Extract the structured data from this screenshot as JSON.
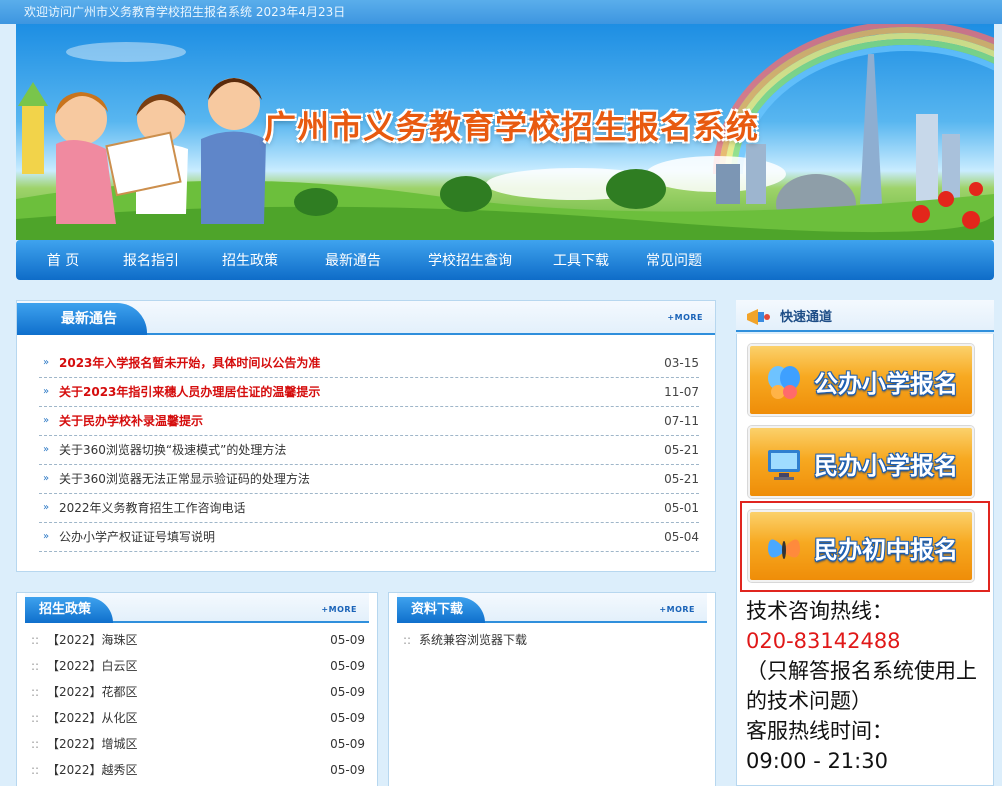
{
  "topbar": {
    "welcome": "欢迎访问广州市义务教育学校招生报名系统 2023年4月23日"
  },
  "banner": {
    "title": "广州市义务教育学校招生报名系统"
  },
  "nav": [
    {
      "label": "首 页"
    },
    {
      "label": "报名指引"
    },
    {
      "label": "招生政策"
    },
    {
      "label": "最新通告"
    },
    {
      "label": "学校招生查询"
    },
    {
      "label": "工具下载"
    },
    {
      "label": "常见问题"
    }
  ],
  "notices": {
    "title": "最新通告",
    "more": "+MORE",
    "items": [
      {
        "text": "2023年入学报名暂未开始，具体时间以公告为准",
        "date": "03-15",
        "highlight": true
      },
      {
        "text": "关于2023年指引来穗人员办理居住证的温馨提示",
        "date": "11-07",
        "highlight": true
      },
      {
        "text": "关于民办学校补录温馨提示",
        "date": "07-11",
        "highlight": true
      },
      {
        "text": "关于360浏览器切换“极速模式”的处理方法",
        "date": "05-21",
        "highlight": false
      },
      {
        "text": "关于360浏览器无法正常显示验证码的处理方法",
        "date": "05-21",
        "highlight": false
      },
      {
        "text": "2022年义务教育招生工作咨询电话",
        "date": "05-01",
        "highlight": false
      },
      {
        "text": "公办小学产权证证号填写说明",
        "date": "05-04",
        "highlight": false
      }
    ]
  },
  "policy": {
    "title": "招生政策",
    "more": "+MORE",
    "items": [
      {
        "text": "【2022】海珠区",
        "date": "05-09"
      },
      {
        "text": "【2022】白云区",
        "date": "05-09"
      },
      {
        "text": "【2022】花都区",
        "date": "05-09"
      },
      {
        "text": "【2022】从化区",
        "date": "05-09"
      },
      {
        "text": "【2022】增城区",
        "date": "05-09"
      },
      {
        "text": "【2022】越秀区",
        "date": "05-09"
      }
    ]
  },
  "downloads": {
    "title": "资料下载",
    "more": "+MORE",
    "items": [
      {
        "text": "系统兼容浏览器下载"
      }
    ]
  },
  "quick": {
    "title": "快速通道",
    "buttons": [
      {
        "label": "公办小学报名",
        "icon": "butterfly-icon"
      },
      {
        "label": "民办小学报名",
        "icon": "computer-icon"
      },
      {
        "label": "民办初中报名",
        "icon": "butterfly-icon"
      }
    ]
  },
  "hotline": {
    "label": "技术咨询热线：",
    "phone": "020-83142488",
    "note": "（只解答报名系统使用上的技术问题）",
    "hours_label": "客服热线时间：",
    "hours": "09:00 - 21:30"
  },
  "colors": {
    "accent": "#0e6cc8",
    "alert": "#d50d0d",
    "button": "#f7a921"
  }
}
